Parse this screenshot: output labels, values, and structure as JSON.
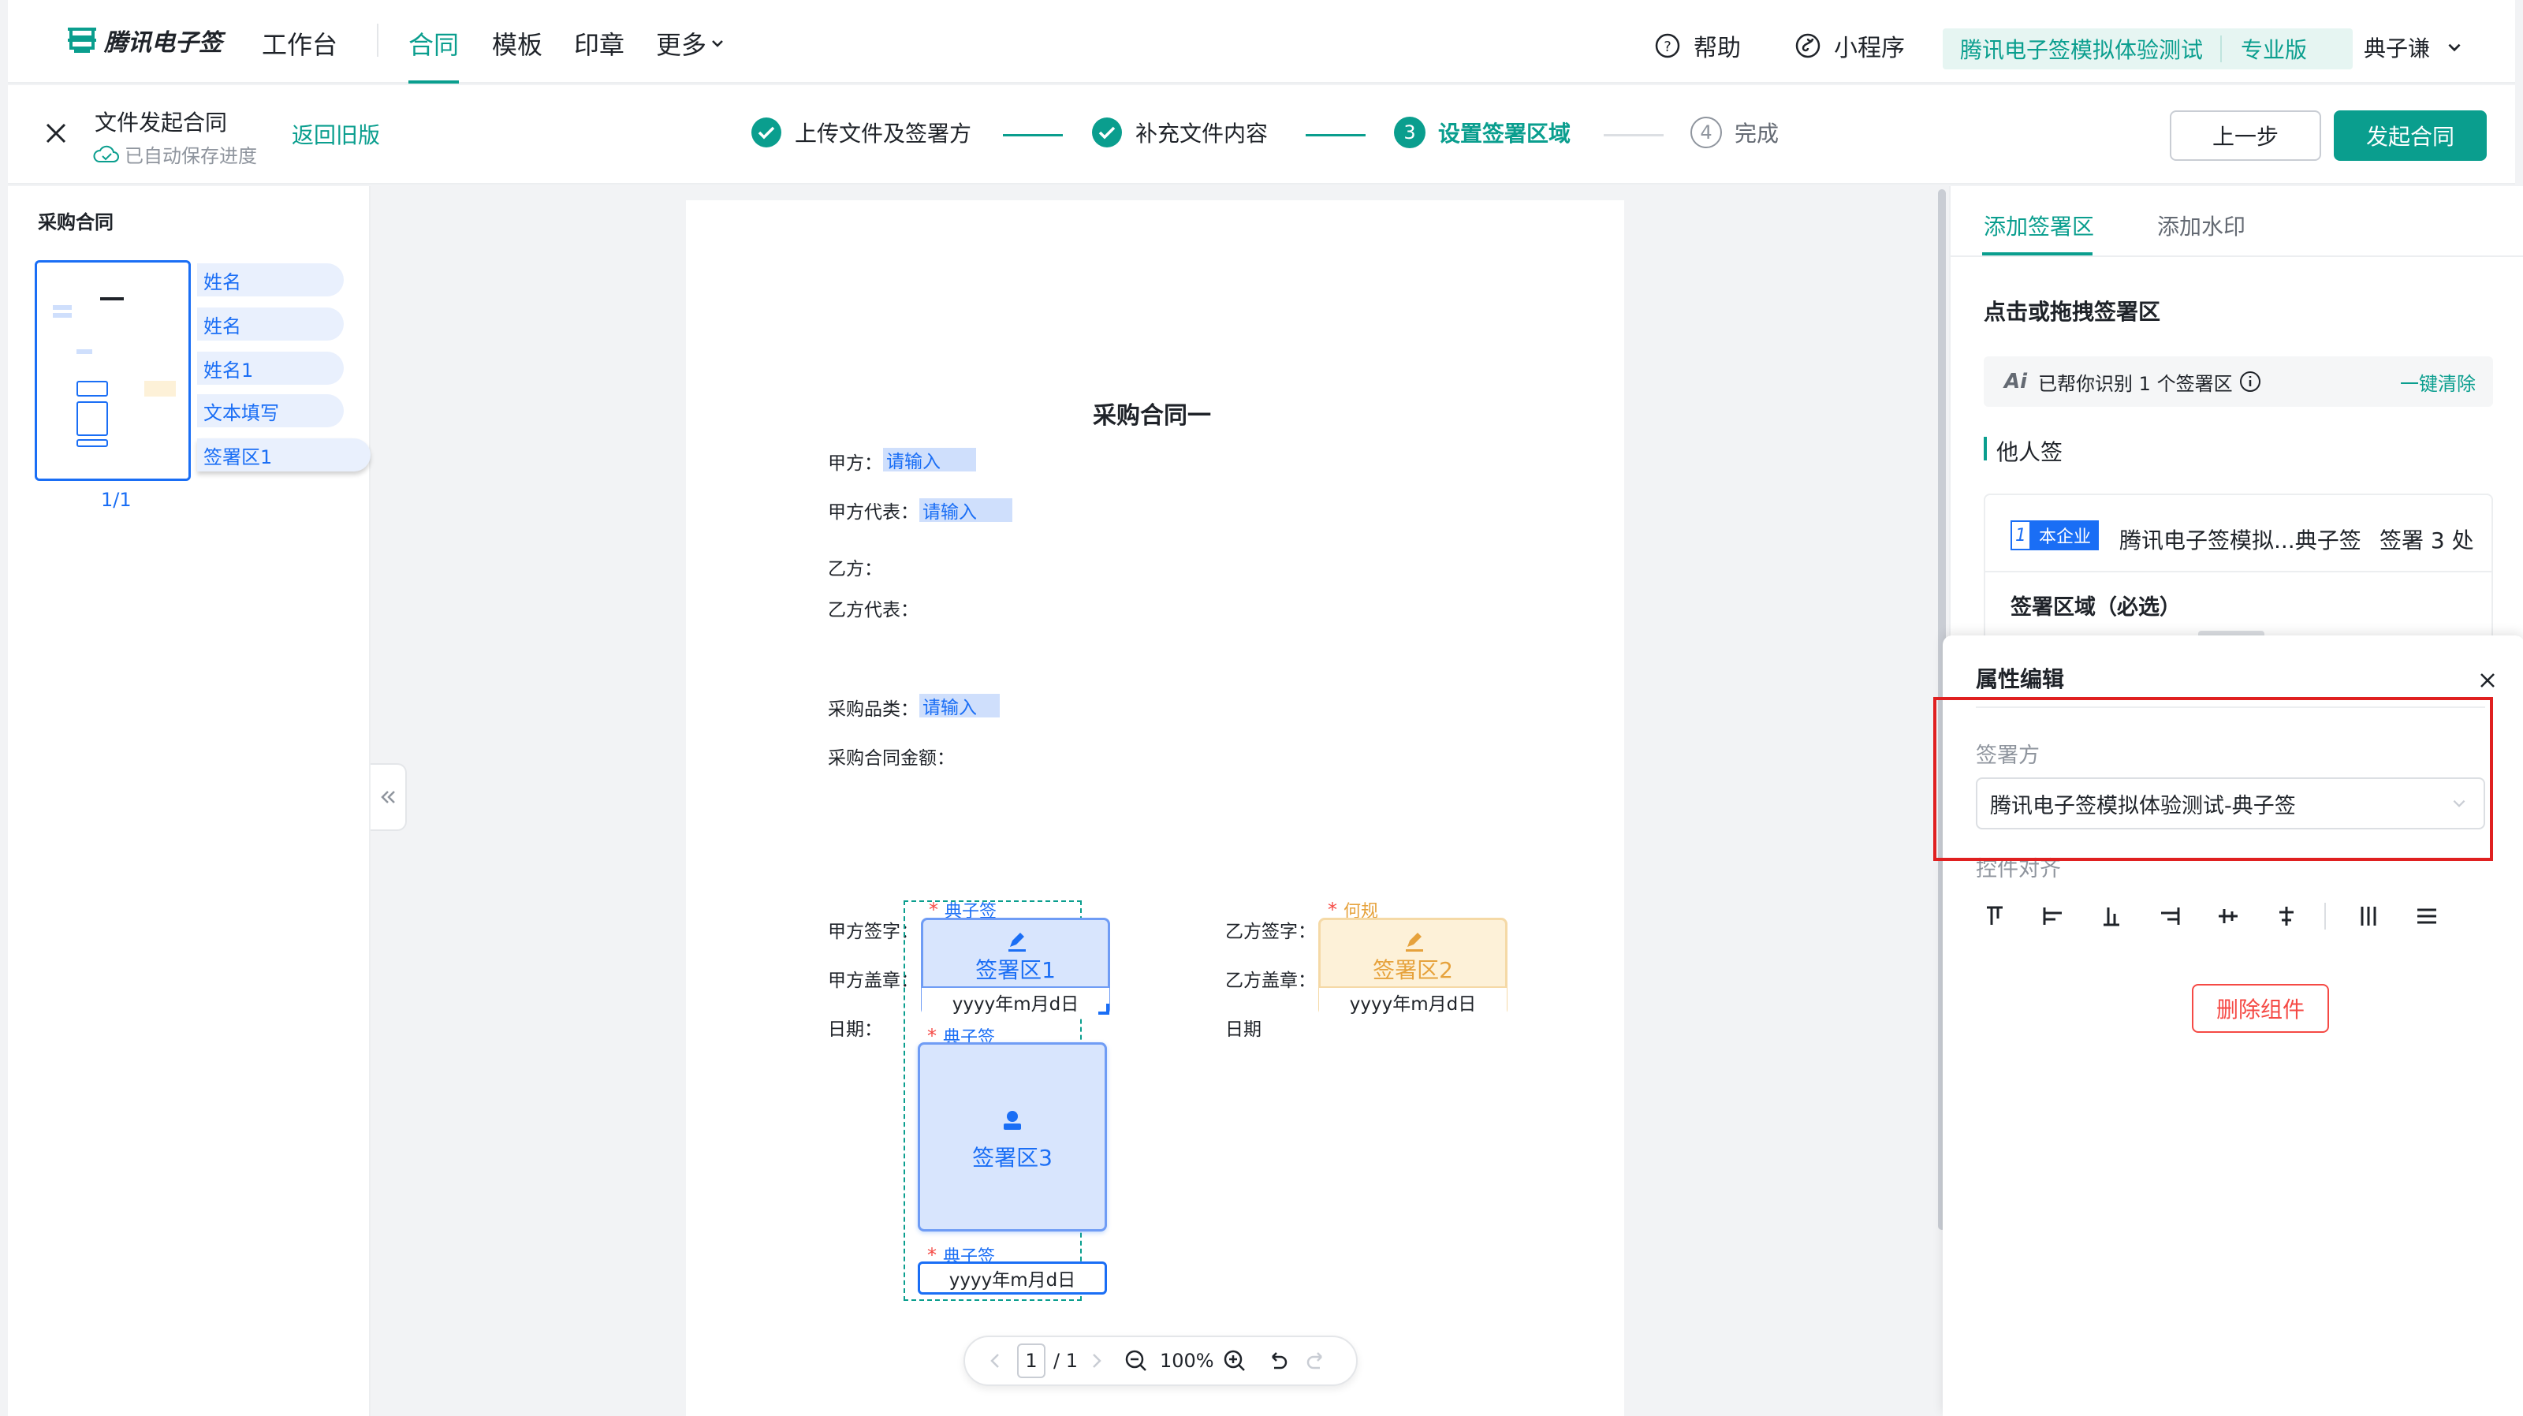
{
  "brand": {
    "name": "腾讯电子签"
  },
  "nav": {
    "items": [
      "工作台",
      "合同",
      "模板",
      "印章",
      "更多"
    ],
    "help": "帮助",
    "miniprogram": "小程序",
    "org": "腾讯电子签模拟体验测试",
    "plan": "专业版",
    "user": "典子谦"
  },
  "header": {
    "title": "文件发起合同",
    "saved": "已自动保存进度",
    "back_old": "返回旧版"
  },
  "steps": [
    {
      "label": "上传文件及签署方",
      "state": "done"
    },
    {
      "label": "补充文件内容",
      "state": "done"
    },
    {
      "num": "3",
      "label": "设置签署区域",
      "state": "active"
    },
    {
      "num": "4",
      "label": "完成",
      "state": "todo"
    }
  ],
  "actions": {
    "prev": "上一步",
    "start": "发起合同"
  },
  "left": {
    "title": "采购合同",
    "fields": [
      "姓名",
      "姓名",
      "姓名1",
      "文本填写",
      "签署区1"
    ],
    "page": "1/1"
  },
  "doc": {
    "title": "采购合同一",
    "party_a": "甲方：",
    "party_a_rep": "甲方代表：",
    "party_b": "乙方：",
    "party_b_rep": "乙方代表：",
    "category": "采购品类：",
    "amount": "采购合同金额：",
    "placeholder": "请输入",
    "a_sign": "甲方签字：",
    "a_seal": "甲方盖章：",
    "a_date": "日期：",
    "b_sign": "乙方签字：",
    "b_seal": "乙方盖章：",
    "b_date": "日期",
    "signer_a": "典子签",
    "signer_b": "何规",
    "zone1": "签署区1",
    "zone2": "签署区2",
    "zone3": "签署区3",
    "date_fmt": "yyyy年m月d日"
  },
  "pager": {
    "current": "1",
    "total": "/ 1",
    "zoom": "100%"
  },
  "right": {
    "tabs": [
      "添加签署区",
      "添加水印"
    ],
    "section_title": "点击或拖拽签署区",
    "ai_text": "已帮你识别 1 个签署区",
    "clear": "一键清除",
    "group": "他人签",
    "signer_num": "1",
    "signer_badge": "本企业",
    "signer_name": "腾讯电子签模拟...典子签",
    "signer_count": "签署 3 处",
    "zone_required": "签署区域（必选）",
    "props_title": "属性编辑",
    "signer_label": "签署方",
    "signer_value": "腾讯电子签模拟体验测试-典子签",
    "align_label": "控件对齐",
    "delete": "删除组件"
  },
  "colors": {
    "accent": "#0a9e8e",
    "blue": "#1a6ef5",
    "danger": "#f54a45",
    "warning": "#e6a23c"
  }
}
